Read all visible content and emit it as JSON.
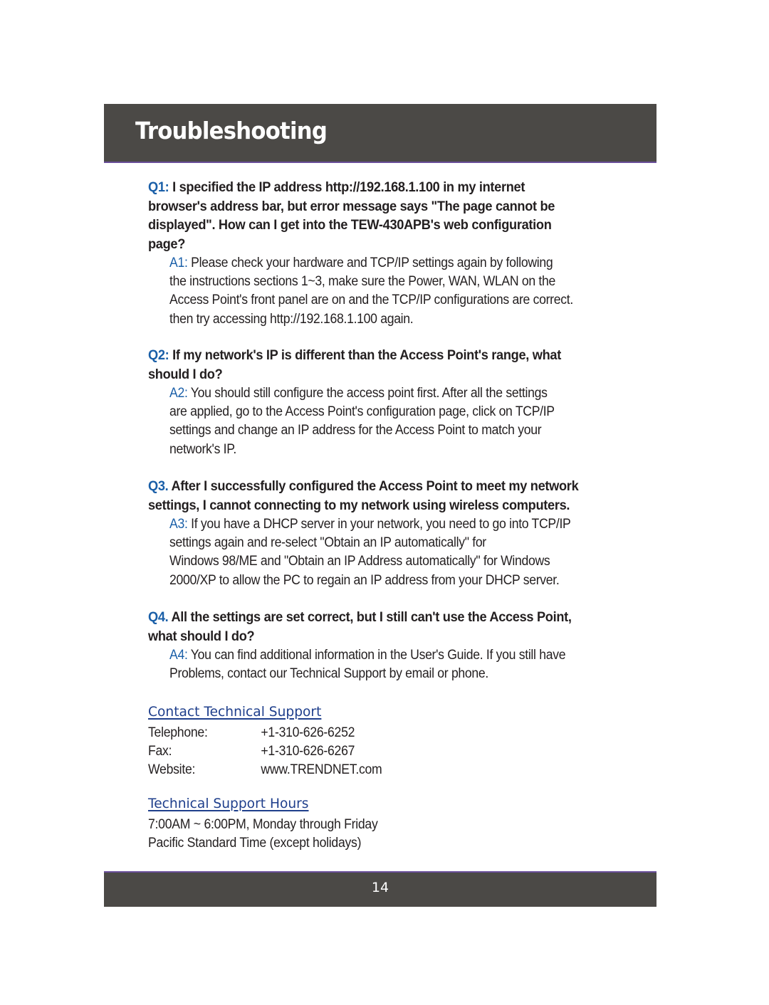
{
  "header": {
    "title": "Troubleshooting"
  },
  "faq": [
    {
      "q_label": "Q1:",
      "q_lines": [
        " I specified the IP address http://192.168.1.100 in my internet",
        "browser's address bar, but error message says \"The page cannot be",
        "displayed\". How can I get into the TEW-430APB's web configuration",
        "page?"
      ],
      "a_label": "A1:",
      "a_lines": [
        " Please check your hardware and TCP/IP settings again by following",
        "the instructions  sections 1~3, make sure the Power, WAN, WLAN on the",
        "Access Point's front panel are on and the TCP/IP configurations are correct.",
        "then try accessing http://192.168.1.100 again."
      ]
    },
    {
      "q_label": "Q2:",
      "q_lines": [
        " If my network's IP is different than the Access Point's range, what",
        "should I do?"
      ],
      "a_label": "A2:",
      "a_lines": [
        " You should still configure the access point first. After all the settings",
        "are applied, go to the Access Point's configuration page, click on TCP/IP",
        "settings and change an IP address for the Access Point to match your",
        "network's IP."
      ]
    },
    {
      "q_label": "Q3.",
      "q_lines": [
        " After I successfully configured the Access Point to meet my network",
        "settings, I cannot connecting to my network using wireless computers."
      ],
      "a_label": "A3:",
      "a_lines": [
        " If you have a DHCP server in your network, you need to go into TCP/IP",
        "settings again and re-select \"Obtain an IP automatically\" for",
        "Windows 98/ME and \"Obtain an IP Address automatically\" for Windows",
        "2000/XP to allow the PC to regain an IP address from your DHCP server."
      ]
    },
    {
      "q_label": "Q4.",
      "q_lines": [
        " All the settings are set correct, but I still can't use the Access Point,",
        "what should I do?"
      ],
      "a_label": "A4:",
      "a_lines": [
        " You can find additional information in the User's Guide. If you still have",
        "Problems,  contact our Technical Support by email or phone."
      ]
    }
  ],
  "contact": {
    "heading": "Contact Technical Support",
    "rows": [
      {
        "label": "Telephone:",
        "value": "+1-310-626-6252"
      },
      {
        "label": "Fax:",
        "value": "+1-310-626-6267"
      },
      {
        "label": "Website:",
        "value": "www.TRENDNET.com"
      }
    ]
  },
  "hours": {
    "heading": "Technical Support Hours",
    "lines": [
      "7:00AM ~ 6:00PM, Monday through Friday",
      "Pacific Standard Time (except holidays)"
    ]
  },
  "footer": {
    "page_number": "14"
  },
  "colors": {
    "bar_background": "#4b4946",
    "bar_accent_line": "#6a4f9a",
    "label_blue": "#1a5fa8",
    "heading_blue": "#1f3f8c",
    "body_text": "#231f20"
  }
}
